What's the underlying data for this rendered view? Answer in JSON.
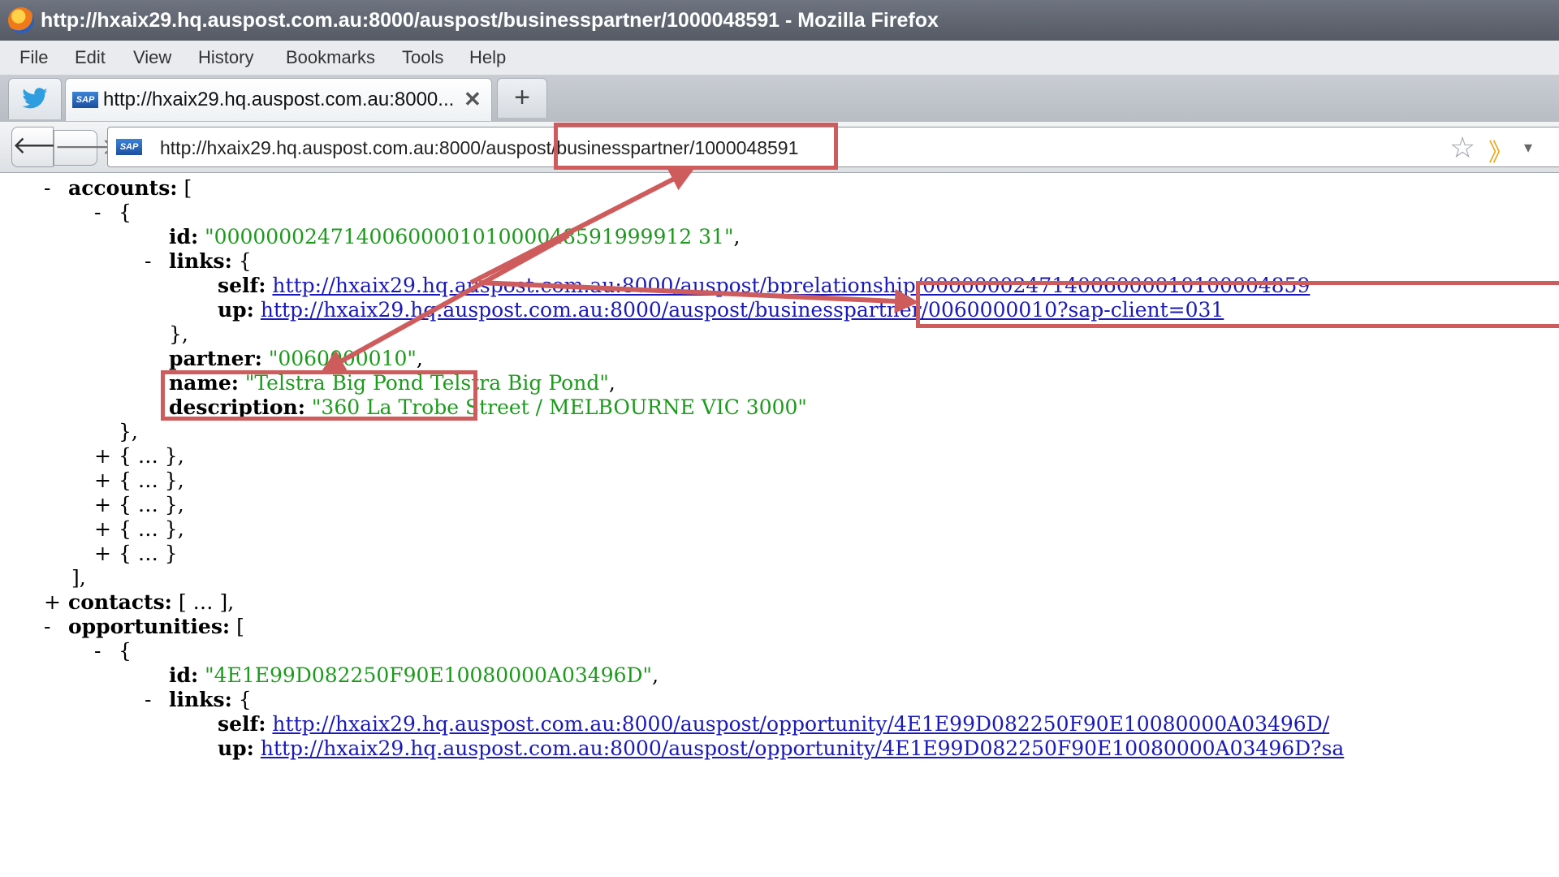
{
  "window": {
    "title": "http://hxaix29.hq.auspost.com.au:8000/auspost/businesspartner/1000048591 - Mozilla Firefox"
  },
  "menu": {
    "file": "File",
    "edit": "Edit",
    "view": "View",
    "history": "History",
    "bookmarks": "Bookmarks",
    "tools": "Tools",
    "help": "Help"
  },
  "tabs": {
    "active_label": "http://hxaix29.hq.auspost.com.au:8000...",
    "close_glyph": "✕",
    "newtab_glyph": "+",
    "sap_badge": "SAP"
  },
  "nav": {
    "url": "http://hxaix29.hq.auspost.com.au:8000/auspost/businesspartner/1000048591"
  },
  "json": {
    "accounts_key": "accounts:",
    "accounts_open": " [",
    "id_key": "id:",
    "id_val": "\"0000000247140060000101000048591999912 31\"",
    "links_key": "links:",
    "self_key": "self:",
    "self_url": "http://hxaix29.hq.auspost.com.au:8000/auspost/bprelationship/000000024714006000010100004859",
    "up_key": "up:",
    "up_url": "http://hxaix29.hq.auspost.com.au:8000/auspost/businesspartner/0060000010?sap-client=031",
    "partner_key": "partner:",
    "partner_val": "\"0060000010\"",
    "name_key": "name:",
    "name_val": "\"Telstra Big Pond Telstra Big Pond\"",
    "description_key": "description:",
    "description_val": "\"360 La Trobe Street / MELBOURNE VIC 3000\"",
    "collapsed": "{ … },",
    "collapsed_last": "{ … }",
    "contacts_key": "contacts:",
    "contacts_val": " [ … ],",
    "opportunities_key": "opportunities:",
    "opp_id_val": "\"4E1E99D082250F90E10080000A03496D\"",
    "opp_self_url": "http://hxaix29.hq.auspost.com.au:8000/auspost/opportunity/4E1E99D082250F90E10080000A03496D/",
    "opp_up_url": "http://hxaix29.hq.auspost.com.au:8000/auspost/opportunity/4E1E99D082250F90E10080000A03496D?sa"
  },
  "colors": {
    "annotation": "#cf5c5c",
    "string": "#1b9b1b",
    "link": "#1a1ab8"
  }
}
